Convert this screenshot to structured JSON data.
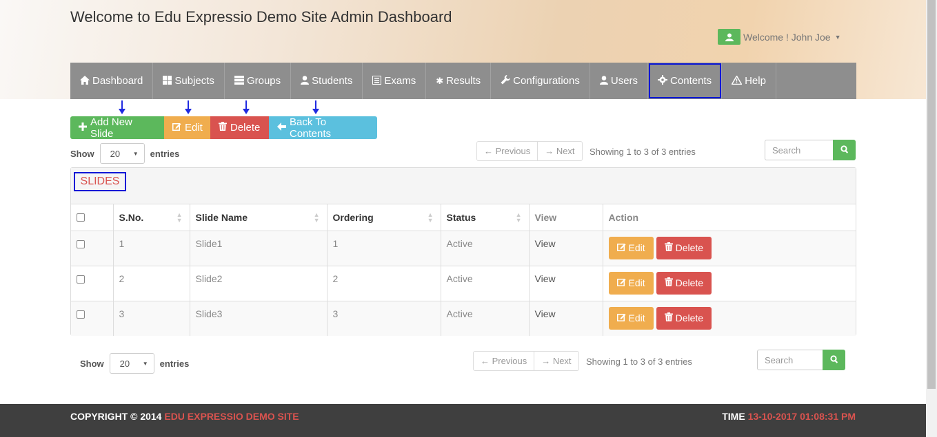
{
  "header": {
    "title": "Welcome to Edu Expressio Demo Site Admin Dashboard",
    "user_label": "Welcome ! John Joe"
  },
  "nav": {
    "items": [
      {
        "label": "Dashboard",
        "icon": "home-icon"
      },
      {
        "label": "Subjects",
        "icon": "grid-icon"
      },
      {
        "label": "Groups",
        "icon": "server-icon"
      },
      {
        "label": "Students",
        "icon": "user-icon"
      },
      {
        "label": "Exams",
        "icon": "list-icon"
      },
      {
        "label": "Results",
        "icon": "asterisk-icon"
      },
      {
        "label": "Configurations",
        "icon": "wrench-icon"
      },
      {
        "label": "Users",
        "icon": "user-icon"
      },
      {
        "label": "Contents",
        "icon": "gear-icon"
      },
      {
        "label": "Help",
        "icon": "warning-icon"
      }
    ],
    "active": "Contents"
  },
  "toolbar": {
    "add_label": "Add New Slide",
    "edit_label": "Edit",
    "delete_label": "Delete",
    "back_label": "Back To Contents"
  },
  "list_controls": {
    "show_label": "Show",
    "entries_label": "entries",
    "page_length": "20",
    "previous_label": "← Previous",
    "next_label": "→ Next",
    "info": "Showing 1 to 3 of 3 entries",
    "search_placeholder": "Search"
  },
  "panel": {
    "title": "SLIDES"
  },
  "table": {
    "columns": [
      "S.No.",
      "Slide Name",
      "Ordering",
      "Status",
      "View",
      "Action"
    ],
    "rows": [
      {
        "sno": "1",
        "name": "Slide1",
        "ordering": "1",
        "status": "Active",
        "view": "View"
      },
      {
        "sno": "2",
        "name": "Slide2",
        "ordering": "2",
        "status": "Active",
        "view": "View"
      },
      {
        "sno": "3",
        "name": "Slide3",
        "ordering": "3",
        "status": "Active",
        "view": "View"
      }
    ],
    "row_edit_label": "Edit",
    "row_delete_label": "Delete"
  },
  "footer": {
    "copyright_prefix": "COPYRIGHT © 2014",
    "site_name": "EDU EXPRESSIO DEMO SITE",
    "time_label": "TIME",
    "time_value": "13-10-2017 01:08:31 PM"
  },
  "colors": {
    "nav_bg": "#8e8e8e",
    "green": "#5cb85c",
    "orange": "#f0ad4e",
    "red": "#d9534f",
    "blue": "#5bc0de",
    "highlight": "#0a16d6"
  }
}
